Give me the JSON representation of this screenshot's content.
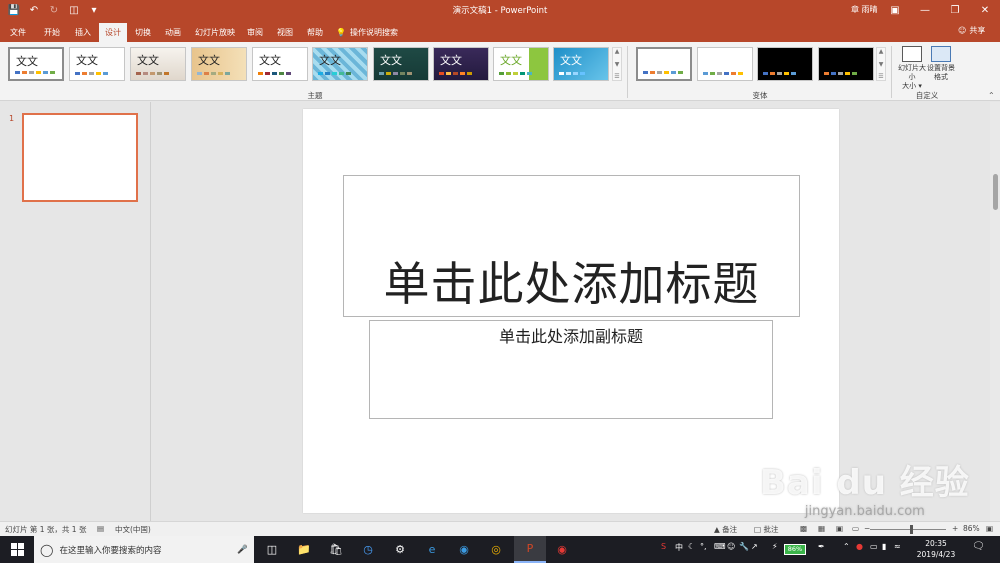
{
  "titlebar": {
    "title": "演示文稿1  -  PowerPoint",
    "user": "章 雨晴",
    "qat": [
      "save-icon",
      "undo-icon",
      "redo-icon",
      "start-from-beginning-icon",
      "customize-qat-icon"
    ]
  },
  "tabs": [
    "文件",
    "开始",
    "插入",
    "设计",
    "切换",
    "动画",
    "幻灯片放映",
    "审阅",
    "视图",
    "帮助"
  ],
  "active_tab": "设计",
  "tell_me": "操作说明搜索",
  "share": "共享",
  "ribbon": {
    "themes_label": "主题",
    "theme_sample_text": "文文",
    "variants_label": "变体",
    "customize_label": "自定义",
    "slide_size": "幻灯片大小",
    "slide_size_arrow": "大小 ▾",
    "format_background": "设置背景格式"
  },
  "slide_pane": {
    "slide_number": "1"
  },
  "slide": {
    "title_placeholder": "单击此处添加标题",
    "subtitle_placeholder": "单击此处添加副标题"
  },
  "statusbar": {
    "slide_info": "幻灯片 第 1 张，共 1 张",
    "language": "中文(中国)",
    "notes": "备注",
    "comments": "批注",
    "zoom_minus": "−",
    "zoom_plus": "+",
    "zoom": "86%"
  },
  "taskbar": {
    "search_placeholder": "在这里输入你要搜索的内容",
    "battery": "86%",
    "time": "20:35",
    "date": "2019/4/23",
    "ime": "中"
  },
  "watermark": {
    "brand": "Bai du 经验",
    "url": "jingyan.baidu.com"
  },
  "colors": {
    "accent": "#b7472a",
    "thumb_border": "#e0714a"
  }
}
